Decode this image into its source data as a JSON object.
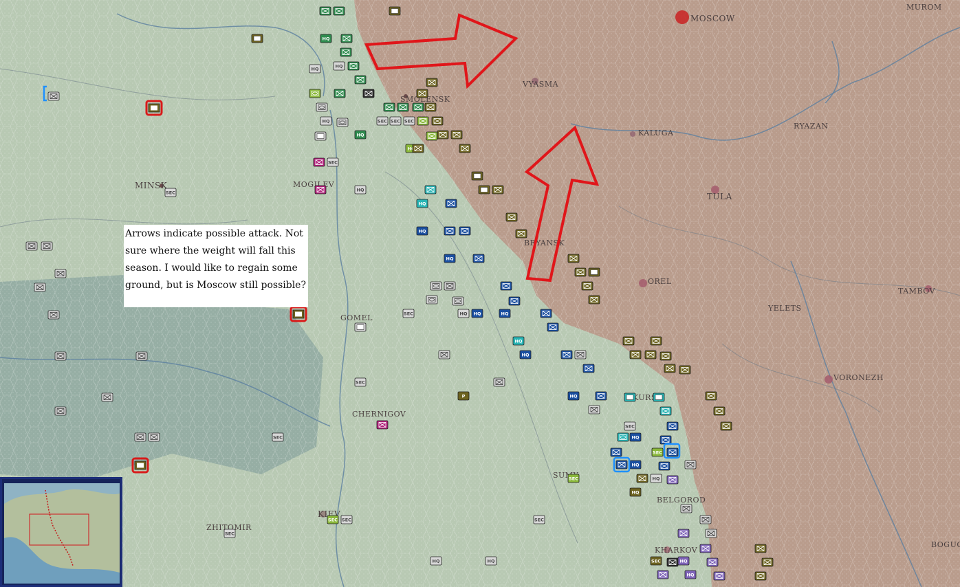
{
  "cities": [
    {
      "id": "moscow",
      "label": "MOSCOW"
    },
    {
      "id": "smolensk",
      "label": "SMOLENSK"
    },
    {
      "id": "minsk",
      "label": "MINSK"
    },
    {
      "id": "mogilev",
      "label": "MOGILEV"
    },
    {
      "id": "vyasma",
      "label": "VYASMA"
    },
    {
      "id": "kaluga",
      "label": "KALUGA"
    },
    {
      "id": "ryazan",
      "label": "RYAZAN"
    },
    {
      "id": "tula",
      "label": "TULA"
    },
    {
      "id": "orel",
      "label": "OREL"
    },
    {
      "id": "tambov",
      "label": "TAMBOV"
    },
    {
      "id": "yelets",
      "label": "YELETS"
    },
    {
      "id": "voronezh",
      "label": "VORONEZH"
    },
    {
      "id": "kursk",
      "label": "KURSK"
    },
    {
      "id": "gomel",
      "label": "GOMEL"
    },
    {
      "id": "chernigov",
      "label": "CHERNIGOV"
    },
    {
      "id": "sumy",
      "label": "SUMY"
    },
    {
      "id": "belgorod",
      "label": "BELGOROD"
    },
    {
      "id": "kharkov",
      "label": "KHARKOV"
    },
    {
      "id": "kiev",
      "label": "KIEV"
    },
    {
      "id": "bryansk",
      "label": "BRYANSK"
    },
    {
      "id": "zhitomir",
      "label": "ZHITOMIR"
    },
    {
      "id": "murom",
      "label": "MUROM"
    },
    {
      "id": "bogucher",
      "label": "BOGUCHAR"
    }
  ],
  "note": {
    "text": "Arrows indicate possible attack. Not sure where the weight will fall this season. I would like to regain some ground, but is Moscow still possible?"
  },
  "unit_labels": {
    "hq": "HQ",
    "sec": "SEC",
    "p": "P"
  },
  "colors": {
    "axis_terrain": "#b7c8b4",
    "soviet_terrain": "#b79a8a",
    "arrow": "#e0161a",
    "german_infantry": "#2e8b4e",
    "german_panzer": "#1a4fa0",
    "soviet_unit": "#6d6320",
    "selection": "#d81a1a"
  },
  "minimap": {
    "label": "minimap"
  }
}
